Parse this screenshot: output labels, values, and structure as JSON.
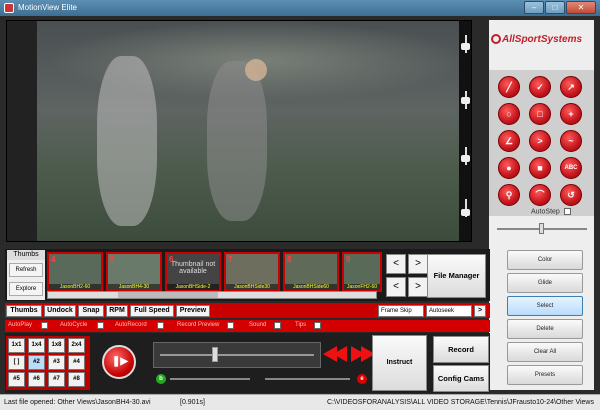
{
  "window": {
    "title": "MotionView Elite",
    "minimize": "–",
    "maximize": "□",
    "close": "✕"
  },
  "brand": {
    "logo_text": "AllSportSystems"
  },
  "tools": [
    {
      "name": "line-tool",
      "glyph": "╱"
    },
    {
      "name": "check-tool",
      "glyph": "✓"
    },
    {
      "name": "arrow-tool",
      "glyph": "↗"
    },
    {
      "name": "circle-tool",
      "glyph": "○"
    },
    {
      "name": "rectangle-tool",
      "glyph": "□"
    },
    {
      "name": "crosshair-tool",
      "glyph": "+"
    },
    {
      "name": "angle-tool",
      "glyph": "∠"
    },
    {
      "name": "chevron-tool",
      "glyph": ">"
    },
    {
      "name": "curve-tool",
      "glyph": "~"
    },
    {
      "name": "spot-tool",
      "glyph": "●"
    },
    {
      "name": "square-tool",
      "glyph": "■"
    },
    {
      "name": "text-tool",
      "glyph": "ABC"
    },
    {
      "name": "magnifier-tool",
      "glyph": "⚲"
    },
    {
      "name": "arc-tool",
      "glyph": "⌒"
    },
    {
      "name": "undo-tool",
      "glyph": "↺"
    }
  ],
  "autostep": {
    "label": "AutoStep"
  },
  "right_buttons": [
    {
      "name": "color-button",
      "label": "Color"
    },
    {
      "name": "glide-button",
      "label": "Glide"
    },
    {
      "name": "select-button",
      "label": "Select"
    },
    {
      "name": "delete-button",
      "label": "Delete"
    },
    {
      "name": "clear-all-button",
      "label": "Clear All"
    },
    {
      "name": "presets-button",
      "label": "Presets"
    }
  ],
  "thumbs_panel": {
    "header": "Thumbs",
    "refresh": "Refresh",
    "explore": "Explore",
    "items": [
      {
        "num": "4",
        "caption": "JasonBH2-60"
      },
      {
        "num": "5",
        "caption": "JasonBH4-30"
      },
      {
        "num": "6",
        "caption": "JasonBHSide-2",
        "na_text": "Thumbnail not available"
      },
      {
        "num": "7",
        "caption": "JasonBHSide30"
      },
      {
        "num": "8",
        "caption": "JasonBHSide60"
      },
      {
        "num": "9",
        "caption": "JasonFH2-60"
      }
    ],
    "prev": "<",
    "next": ">",
    "prev2": "<",
    "next2": ">",
    "file_manager": "File Manager"
  },
  "control_bar": {
    "buttons": [
      "Thumbs",
      "Undock",
      "Snap",
      "RPM",
      "Full Speed",
      "Preview"
    ],
    "frame_skip": "Frame Skip",
    "autoseek": "Autoseek",
    "go": ">"
  },
  "options": [
    "AutoPlay",
    "AutoCycle",
    "AutoRecord",
    "Record Preview",
    "Sound",
    "Tips"
  ],
  "cams": [
    "1x1",
    "1x4",
    "1x8",
    "2x4",
    "[ ]",
    "#2",
    "#3",
    "#4",
    "#5",
    "#6",
    "#7",
    "#8"
  ],
  "playback": {
    "b_label": "b",
    "e_label": "e"
  },
  "actions": {
    "instruct": "Instruct",
    "record": "Record",
    "config_cams": "Config Cams"
  },
  "status": {
    "file": "Last file opened: Other Views\\JasonBH4-30.avi",
    "time": "[0.901s]",
    "path": "C:\\VIDEOSFORANALYSIS\\ALL VIDEO STORAGE\\Tennis\\JFrausto10-24\\Other Views"
  }
}
